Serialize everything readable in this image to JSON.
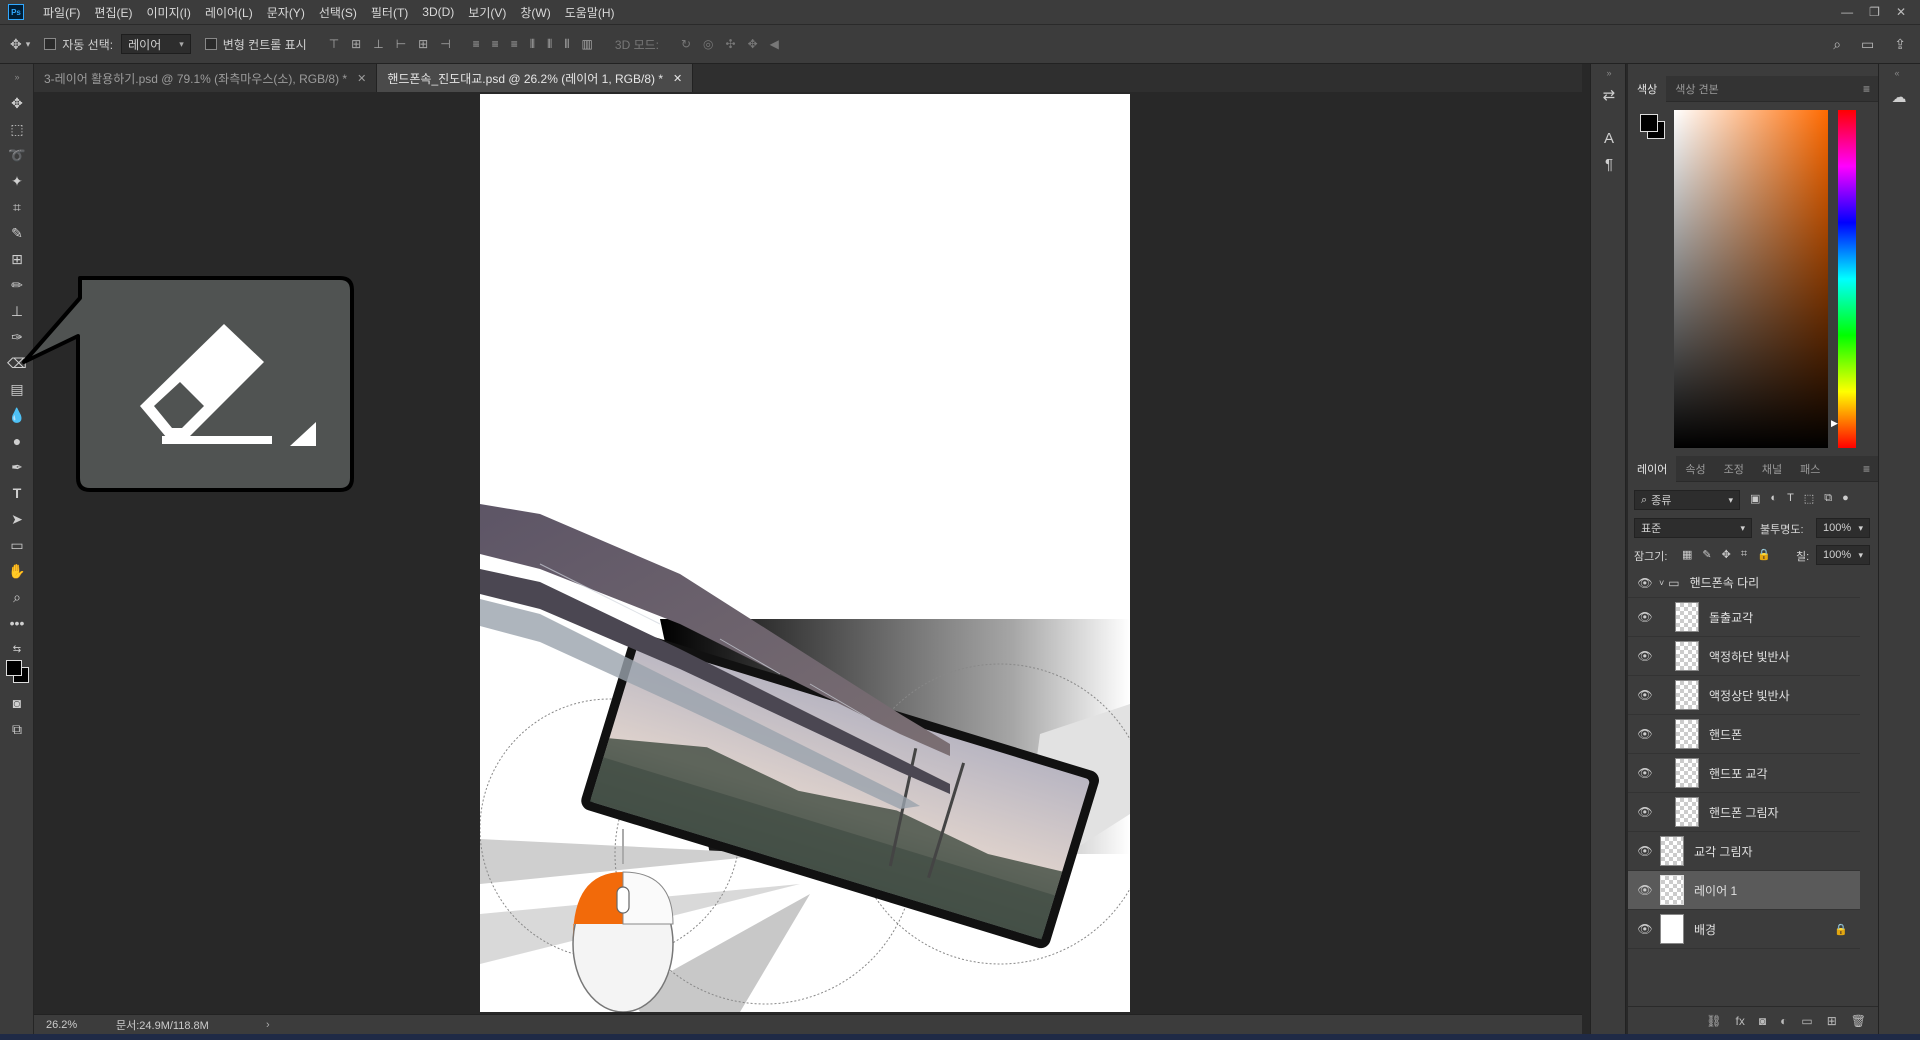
{
  "app": {
    "logo": "Ps"
  },
  "menubar": {
    "items": [
      "파일(F)",
      "편집(E)",
      "이미지(I)",
      "레이어(L)",
      "문자(Y)",
      "선택(S)",
      "필터(T)",
      "3D(D)",
      "보기(V)",
      "창(W)",
      "도움말(H)"
    ]
  },
  "options": {
    "auto_select_label": "자동 선택:",
    "auto_select_value": "레이어",
    "transform_label": "변형 컨트롤 표시",
    "mode3d_label": "3D 모드:"
  },
  "tabs": [
    {
      "label": "3-레이어 활용하기.psd @ 79.1% (좌측마우스(소), RGB/8) *",
      "active": false
    },
    {
      "label": "핸드폰속_진도대교.psd @ 26.2% (레이어 1, RGB/8) *",
      "active": true
    }
  ],
  "status": {
    "zoom": "26.2%",
    "doc": "문서:24.9M/118.8M",
    "arrow": "›"
  },
  "color_panel": {
    "tabs": [
      "색상",
      "색상 견본"
    ],
    "active": "색상",
    "fg": "#000000",
    "bg": "#000000"
  },
  "layers_panel": {
    "tabs": [
      "레이어",
      "속성",
      "조정",
      "채널",
      "패스"
    ],
    "active": "레이어",
    "filter_label": "종류",
    "blend_mode": "표준",
    "opacity_label": "불투명도:",
    "opacity_value": "100%",
    "lock_label": "잠그기:",
    "fill_label": "칠:",
    "fill_value": "100%",
    "group_name": "핸드폰속 다리",
    "layers": [
      {
        "name": "돌출교각"
      },
      {
        "name": "액정하단 빛반사"
      },
      {
        "name": "액정상단 빛반사"
      },
      {
        "name": "핸드폰"
      },
      {
        "name": "핸드포 교각"
      },
      {
        "name": "핸드폰 그림자"
      },
      {
        "name": "교각 그림자"
      },
      {
        "name": "레이어 1"
      },
      {
        "name": "배경"
      }
    ]
  },
  "accent": {
    "mouse_orange": "#f26a0a"
  }
}
